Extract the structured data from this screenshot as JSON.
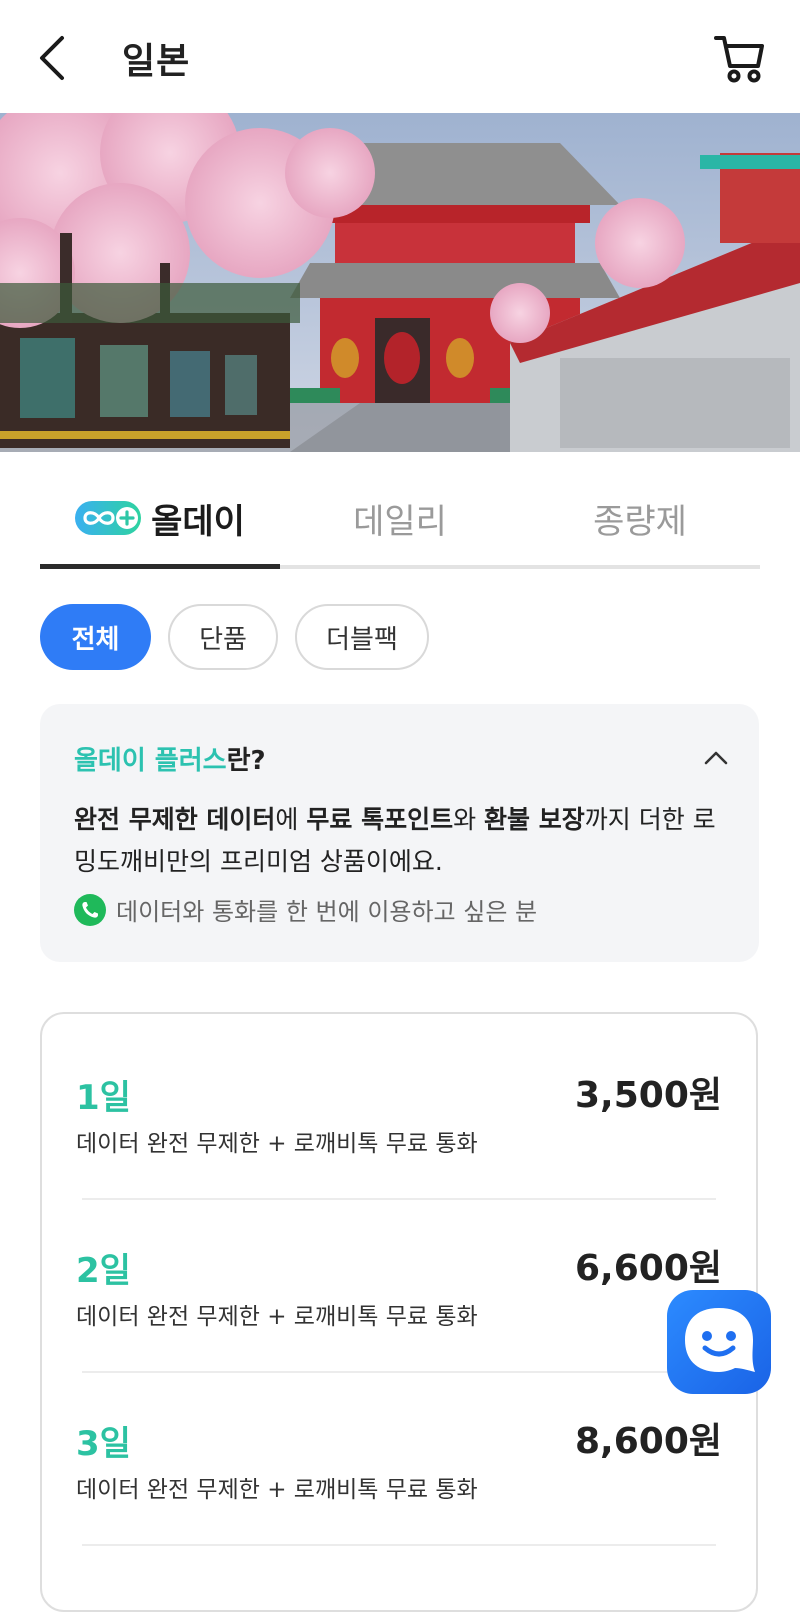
{
  "header": {
    "title": "일본",
    "back_icon": "chevron-left-icon",
    "cart_icon": "cart-icon"
  },
  "tabs": [
    {
      "label": "올데이",
      "active": true
    },
    {
      "label": "데일리",
      "active": false
    },
    {
      "label": "종량제",
      "active": false
    }
  ],
  "filters": [
    {
      "label": "전체",
      "selected": true
    },
    {
      "label": "단품",
      "selected": false
    },
    {
      "label": "더블팩",
      "selected": false
    }
  ],
  "info": {
    "title_accent": "올데이 플러스",
    "title_rest": "란?",
    "desc_parts": [
      "완전 무제한 데이터",
      "에 ",
      "무료 톡포인트",
      "와 ",
      "환불 보장",
      "까지 더한 로밍도깨비만의 프리미엄 상품이에요."
    ],
    "note": "데이터와 통화를 한 번에 이용하고 싶은 분"
  },
  "plans": [
    {
      "day": "1일",
      "desc": "데이터 완전 무제한 + 로깨비톡 무료 통화",
      "price": "3,500원"
    },
    {
      "day": "2일",
      "desc": "데이터 완전 무제한 + 로깨비톡 무료 통화",
      "price": "6,600원"
    },
    {
      "day": "3일",
      "desc": "데이터 완전 무제한 + 로깨비톡 무료 통화",
      "price": "8,600원"
    }
  ],
  "colors": {
    "accent_blue": "#2f7cf6",
    "accent_teal": "#2cc2b0",
    "price_teal": "#2cc2a2"
  }
}
